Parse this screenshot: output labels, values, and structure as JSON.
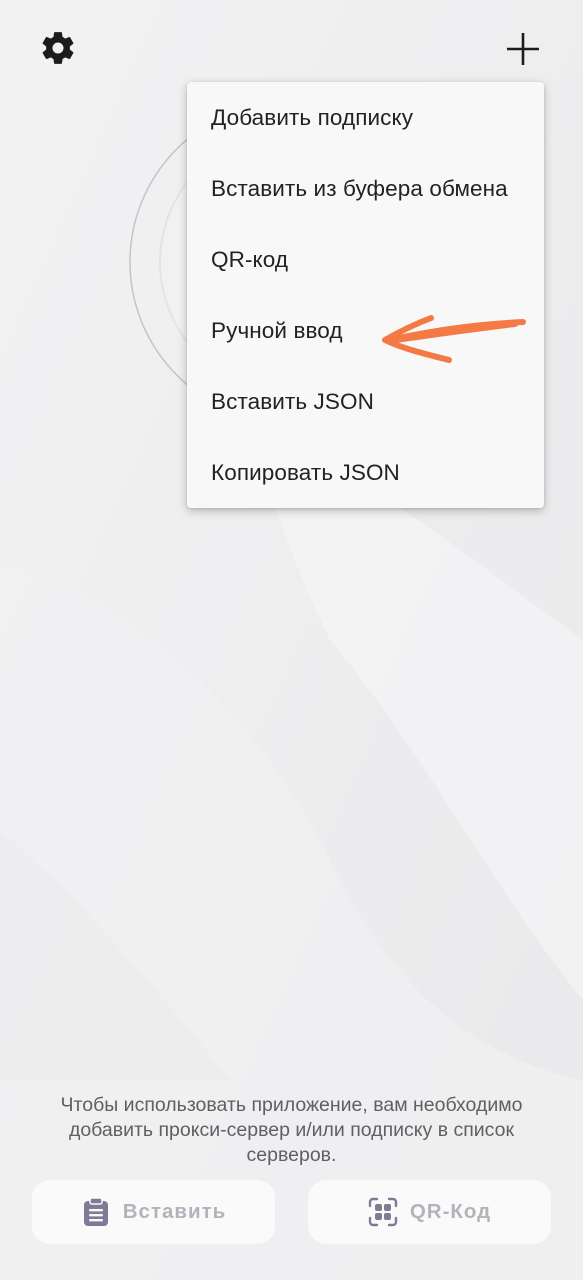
{
  "toolbar": {
    "settings_icon": "gear-icon",
    "add_icon": "plus-icon"
  },
  "menu": {
    "items": [
      {
        "label": "Добавить подписку"
      },
      {
        "label": "Вставить из буфера обмена"
      },
      {
        "label": "QR-код"
      },
      {
        "label": "Ручной ввод"
      },
      {
        "label": "Вставить JSON"
      },
      {
        "label": "Копировать JSON"
      }
    ],
    "highlighted_item": "Ручной ввод"
  },
  "annotation": {
    "arrow_color": "#f47a45"
  },
  "empty_state": {
    "hint": "Чтобы использовать приложение, вам необходимо добавить прокси-сервер и/или подписку в список серверов."
  },
  "actions": {
    "paste_label": "Вставить",
    "paste_icon": "clipboard-icon",
    "qr_label": "QR-Код",
    "qr_icon": "qr-scan-icon",
    "icon_color": "#7f7b96"
  }
}
